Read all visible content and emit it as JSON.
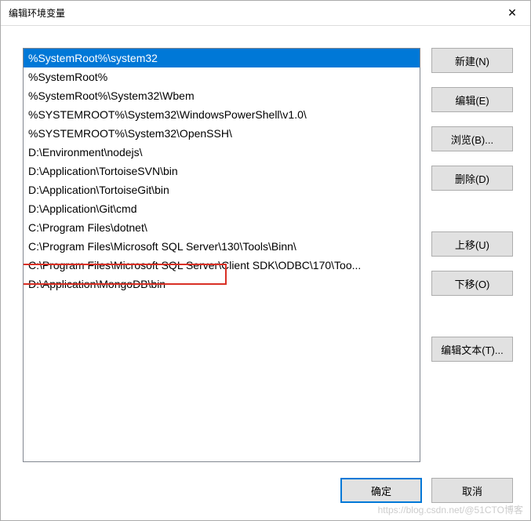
{
  "window": {
    "title": "编辑环境变量"
  },
  "list": {
    "selected_index": 0,
    "highlight_index": 12,
    "items": [
      "%SystemRoot%\\system32",
      "%SystemRoot%",
      "%SystemRoot%\\System32\\Wbem",
      "%SYSTEMROOT%\\System32\\WindowsPowerShell\\v1.0\\",
      "%SYSTEMROOT%\\System32\\OpenSSH\\",
      "D:\\Environment\\nodejs\\",
      "D:\\Application\\TortoiseSVN\\bin",
      "D:\\Application\\TortoiseGit\\bin",
      "D:\\Application\\Git\\cmd",
      "C:\\Program Files\\dotnet\\",
      "C:\\Program Files\\Microsoft SQL Server\\130\\Tools\\Binn\\",
      "C:\\Program Files\\Microsoft SQL Server\\Client SDK\\ODBC\\170\\Too...",
      "D:\\Application\\MongoDB\\bin"
    ]
  },
  "buttons": {
    "new": "新建(N)",
    "edit": "编辑(E)",
    "browse": "浏览(B)...",
    "delete": "删除(D)",
    "move_up": "上移(U)",
    "move_down": "下移(O)",
    "edit_text": "编辑文本(T)...",
    "ok": "确定",
    "cancel": "取消"
  },
  "watermark": "https://blog.csdn.net/@51CTO博客"
}
